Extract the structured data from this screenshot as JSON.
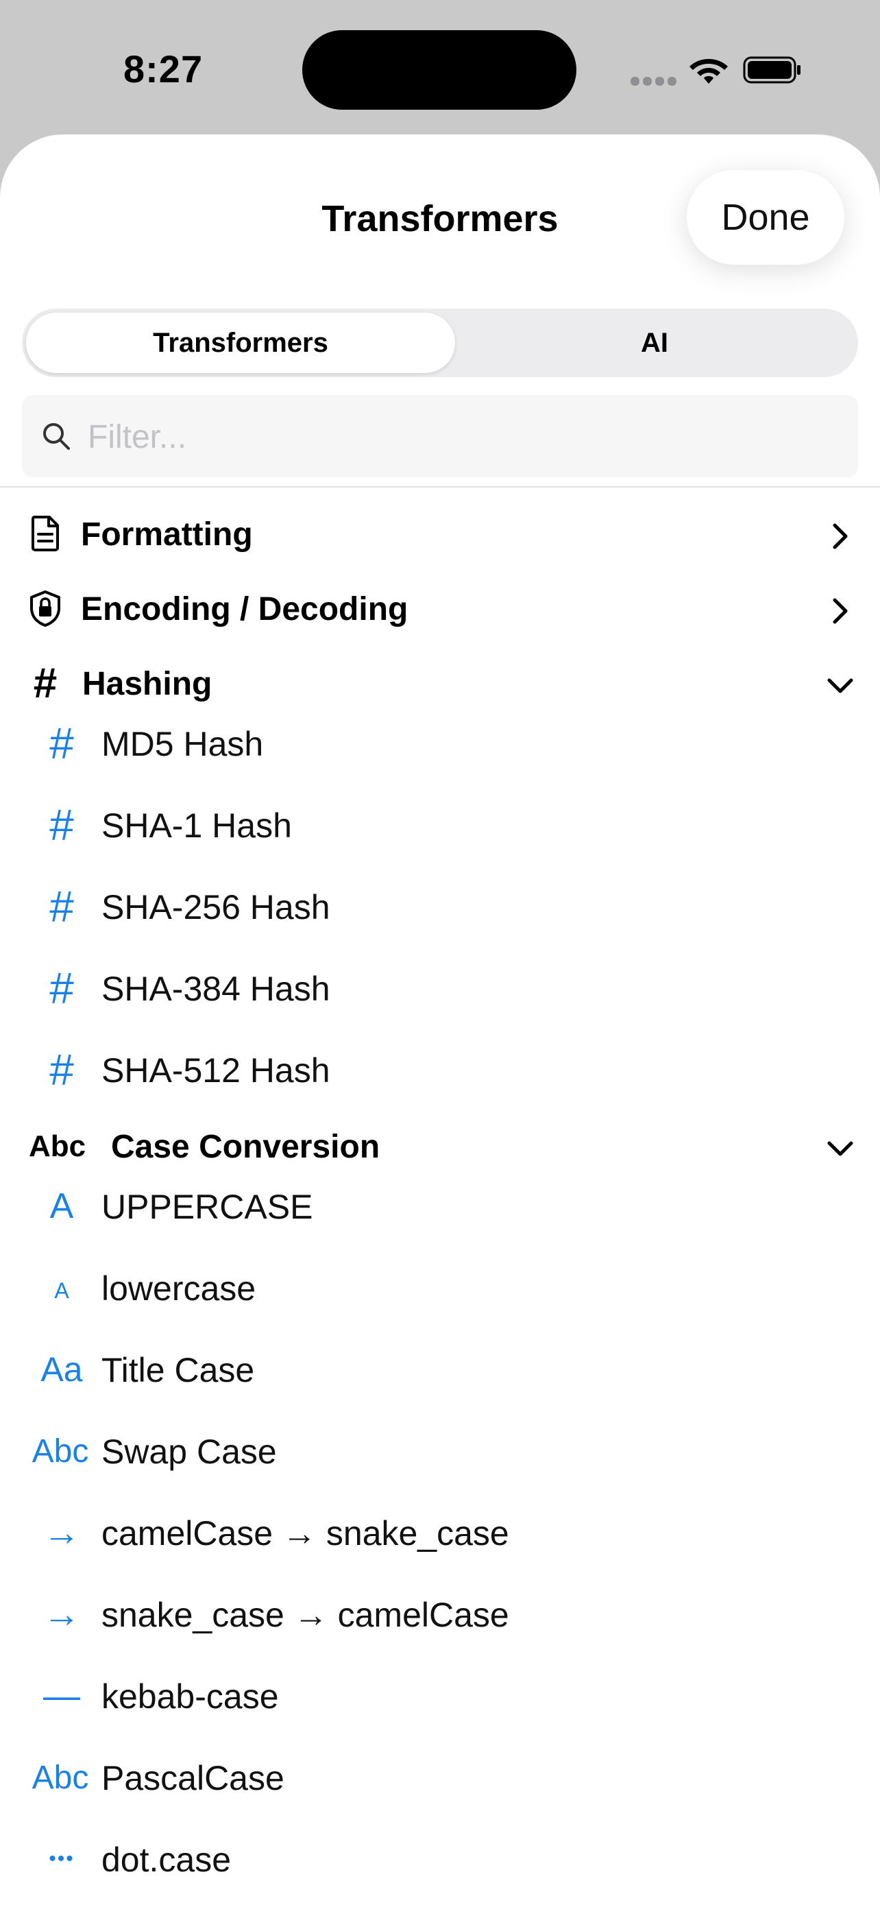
{
  "status_bar": {
    "time": "8:27"
  },
  "sheet": {
    "title": "Transformers",
    "done_label": "Done",
    "tabs": [
      {
        "label": "Transformers",
        "selected": true
      },
      {
        "label": "AI",
        "selected": false
      }
    ],
    "search": {
      "placeholder": "Filter..."
    }
  },
  "groups": [
    {
      "label": "Formatting",
      "icon": "document-icon",
      "expanded": false
    },
    {
      "label": "Encoding / Decoding",
      "icon": "shield-lock-icon",
      "expanded": false
    },
    {
      "label": "Hashing",
      "icon": "number-sign-icon",
      "expanded": true,
      "items": [
        {
          "label": "MD5 Hash",
          "icon_glyph": "#"
        },
        {
          "label": "SHA-1 Hash",
          "icon_glyph": "#"
        },
        {
          "label": "SHA-256 Hash",
          "icon_glyph": "#"
        },
        {
          "label": "SHA-384 Hash",
          "icon_glyph": "#"
        },
        {
          "label": "SHA-512 Hash",
          "icon_glyph": "#"
        }
      ]
    },
    {
      "label": "Case Conversion",
      "icon_glyph": "Abc",
      "expanded": true,
      "items": [
        {
          "label": "UPPERCASE",
          "icon_glyph": "A"
        },
        {
          "label": "lowercase",
          "icon_glyph": "A"
        },
        {
          "label": "Title Case",
          "icon_glyph": "Aa"
        },
        {
          "label": "Swap Case",
          "icon_glyph": "Abc"
        },
        {
          "label": "camelCase → snake_case",
          "icon_glyph": "→"
        },
        {
          "label": "snake_case → camelCase",
          "icon_glyph": "→"
        },
        {
          "label": "kebab-case",
          "icon_glyph": "—"
        },
        {
          "label": "PascalCase",
          "icon_glyph": "Abc"
        },
        {
          "label": "dot.case",
          "icon_glyph": "•••"
        }
      ]
    }
  ],
  "colors": {
    "accent": "#1a82e6",
    "sheet_background": "#ffffff",
    "backdrop": "#c9c9c9"
  }
}
